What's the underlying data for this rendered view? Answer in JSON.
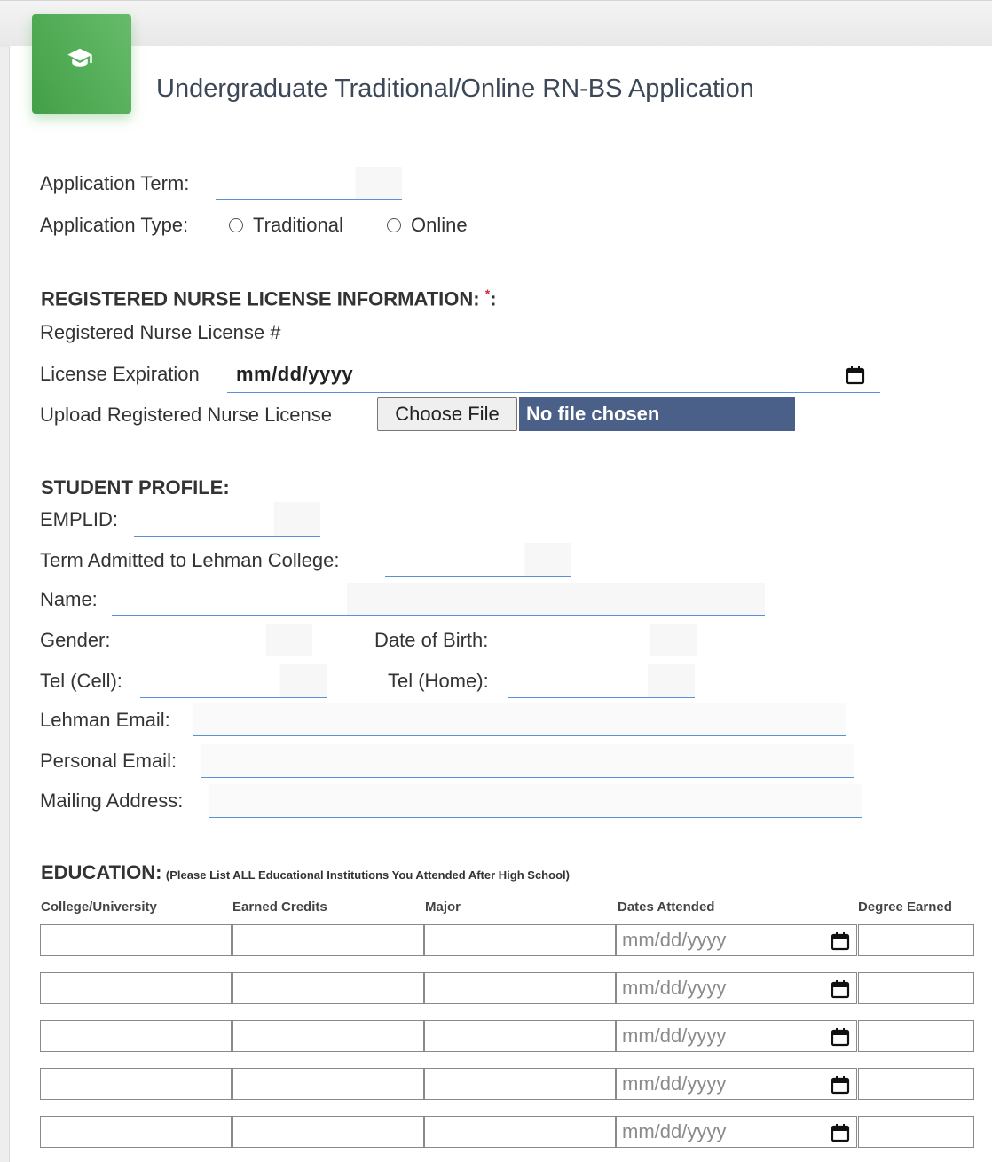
{
  "page": {
    "title": "Undergraduate Traditional/Online RN-BS Application"
  },
  "application": {
    "term_label": "Application Term:",
    "type_label": "Application Type:",
    "type_options": [
      "Traditional",
      "Online"
    ]
  },
  "license": {
    "heading": "REGISTERED NURSE LICENSE INFORMATION:",
    "required_mark": "*",
    "heading_suffix": ":",
    "number_label": "Registered Nurse License #",
    "expiration_label": "License Expiration",
    "expiration_placeholder": "mm/dd/yyyy",
    "upload_label": "Upload Registered Nurse License",
    "choose_file": "Choose File",
    "file_status": "No file chosen"
  },
  "profile": {
    "heading": "STUDENT PROFILE:",
    "emplid_label": "EMPLID:",
    "term_admitted_label": "Term Admitted to Lehman College:",
    "name_label": "Name:",
    "gender_label": "Gender:",
    "dob_label": "Date of Birth:",
    "tel_cell_label": "Tel (Cell):",
    "tel_home_label": "Tel (Home):",
    "lehman_email_label": "Lehman Email:",
    "personal_email_label": "Personal Email:",
    "mailing_address_label": "Mailing Address:"
  },
  "education": {
    "heading": "EDUCATION:",
    "note": "(Please List ALL Educational Institutions You Attended After High School)",
    "columns": [
      "College/University",
      "Earned Credits",
      "Major",
      "Dates Attended",
      "Degree Earned"
    ],
    "date_placeholder": "mm/dd/yyyy",
    "rows": [
      1,
      2,
      3,
      4,
      5
    ]
  },
  "colors": {
    "accent_green": "#4caf50",
    "input_underline": "#5b8fd6",
    "file_status_bg": "#4a6088",
    "title": "#3c4858"
  },
  "icons": {
    "header": "graduation-cap-icon",
    "date": "calendar-icon"
  }
}
